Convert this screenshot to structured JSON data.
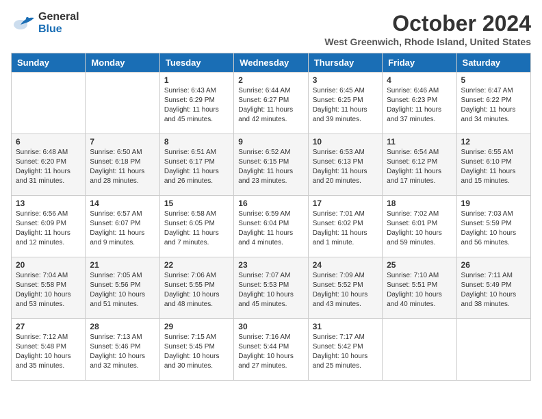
{
  "header": {
    "logo_general": "General",
    "logo_blue": "Blue",
    "month": "October 2024",
    "location": "West Greenwich, Rhode Island, United States"
  },
  "days_of_week": [
    "Sunday",
    "Monday",
    "Tuesday",
    "Wednesday",
    "Thursday",
    "Friday",
    "Saturday"
  ],
  "weeks": [
    [
      {
        "day": "",
        "info": ""
      },
      {
        "day": "",
        "info": ""
      },
      {
        "day": "1",
        "info": "Sunrise: 6:43 AM\nSunset: 6:29 PM\nDaylight: 11 hours and 45 minutes."
      },
      {
        "day": "2",
        "info": "Sunrise: 6:44 AM\nSunset: 6:27 PM\nDaylight: 11 hours and 42 minutes."
      },
      {
        "day": "3",
        "info": "Sunrise: 6:45 AM\nSunset: 6:25 PM\nDaylight: 11 hours and 39 minutes."
      },
      {
        "day": "4",
        "info": "Sunrise: 6:46 AM\nSunset: 6:23 PM\nDaylight: 11 hours and 37 minutes."
      },
      {
        "day": "5",
        "info": "Sunrise: 6:47 AM\nSunset: 6:22 PM\nDaylight: 11 hours and 34 minutes."
      }
    ],
    [
      {
        "day": "6",
        "info": "Sunrise: 6:48 AM\nSunset: 6:20 PM\nDaylight: 11 hours and 31 minutes."
      },
      {
        "day": "7",
        "info": "Sunrise: 6:50 AM\nSunset: 6:18 PM\nDaylight: 11 hours and 28 minutes."
      },
      {
        "day": "8",
        "info": "Sunrise: 6:51 AM\nSunset: 6:17 PM\nDaylight: 11 hours and 26 minutes."
      },
      {
        "day": "9",
        "info": "Sunrise: 6:52 AM\nSunset: 6:15 PM\nDaylight: 11 hours and 23 minutes."
      },
      {
        "day": "10",
        "info": "Sunrise: 6:53 AM\nSunset: 6:13 PM\nDaylight: 11 hours and 20 minutes."
      },
      {
        "day": "11",
        "info": "Sunrise: 6:54 AM\nSunset: 6:12 PM\nDaylight: 11 hours and 17 minutes."
      },
      {
        "day": "12",
        "info": "Sunrise: 6:55 AM\nSunset: 6:10 PM\nDaylight: 11 hours and 15 minutes."
      }
    ],
    [
      {
        "day": "13",
        "info": "Sunrise: 6:56 AM\nSunset: 6:09 PM\nDaylight: 11 hours and 12 minutes."
      },
      {
        "day": "14",
        "info": "Sunrise: 6:57 AM\nSunset: 6:07 PM\nDaylight: 11 hours and 9 minutes."
      },
      {
        "day": "15",
        "info": "Sunrise: 6:58 AM\nSunset: 6:05 PM\nDaylight: 11 hours and 7 minutes."
      },
      {
        "day": "16",
        "info": "Sunrise: 6:59 AM\nSunset: 6:04 PM\nDaylight: 11 hours and 4 minutes."
      },
      {
        "day": "17",
        "info": "Sunrise: 7:01 AM\nSunset: 6:02 PM\nDaylight: 11 hours and 1 minute."
      },
      {
        "day": "18",
        "info": "Sunrise: 7:02 AM\nSunset: 6:01 PM\nDaylight: 10 hours and 59 minutes."
      },
      {
        "day": "19",
        "info": "Sunrise: 7:03 AM\nSunset: 5:59 PM\nDaylight: 10 hours and 56 minutes."
      }
    ],
    [
      {
        "day": "20",
        "info": "Sunrise: 7:04 AM\nSunset: 5:58 PM\nDaylight: 10 hours and 53 minutes."
      },
      {
        "day": "21",
        "info": "Sunrise: 7:05 AM\nSunset: 5:56 PM\nDaylight: 10 hours and 51 minutes."
      },
      {
        "day": "22",
        "info": "Sunrise: 7:06 AM\nSunset: 5:55 PM\nDaylight: 10 hours and 48 minutes."
      },
      {
        "day": "23",
        "info": "Sunrise: 7:07 AM\nSunset: 5:53 PM\nDaylight: 10 hours and 45 minutes."
      },
      {
        "day": "24",
        "info": "Sunrise: 7:09 AM\nSunset: 5:52 PM\nDaylight: 10 hours and 43 minutes."
      },
      {
        "day": "25",
        "info": "Sunrise: 7:10 AM\nSunset: 5:51 PM\nDaylight: 10 hours and 40 minutes."
      },
      {
        "day": "26",
        "info": "Sunrise: 7:11 AM\nSunset: 5:49 PM\nDaylight: 10 hours and 38 minutes."
      }
    ],
    [
      {
        "day": "27",
        "info": "Sunrise: 7:12 AM\nSunset: 5:48 PM\nDaylight: 10 hours and 35 minutes."
      },
      {
        "day": "28",
        "info": "Sunrise: 7:13 AM\nSunset: 5:46 PM\nDaylight: 10 hours and 32 minutes."
      },
      {
        "day": "29",
        "info": "Sunrise: 7:15 AM\nSunset: 5:45 PM\nDaylight: 10 hours and 30 minutes."
      },
      {
        "day": "30",
        "info": "Sunrise: 7:16 AM\nSunset: 5:44 PM\nDaylight: 10 hours and 27 minutes."
      },
      {
        "day": "31",
        "info": "Sunrise: 7:17 AM\nSunset: 5:42 PM\nDaylight: 10 hours and 25 minutes."
      },
      {
        "day": "",
        "info": ""
      },
      {
        "day": "",
        "info": ""
      }
    ]
  ]
}
